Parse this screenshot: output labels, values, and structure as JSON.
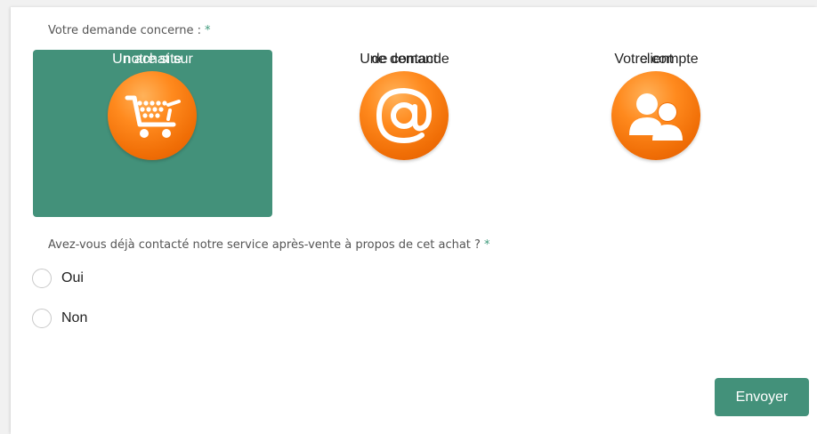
{
  "form": {
    "question1": {
      "label": "Votre demande concerne :",
      "required_mark": "*",
      "choices": [
        {
          "line1": "Un achat sur",
          "line2": "notre site",
          "icon": "shopping-cart-icon",
          "selected": true
        },
        {
          "line1": "Une demande",
          "line2": "de contact",
          "icon": "at-sign-icon",
          "selected": false
        },
        {
          "line1": "Votre compte",
          "line2": "client",
          "icon": "users-icon",
          "selected": false
        }
      ]
    },
    "question2": {
      "label": "Avez-vous déjà contacté notre service après-vente à propos de cet achat ?",
      "required_mark": "*",
      "options": [
        {
          "label": "Oui",
          "checked": false
        },
        {
          "label": "Non",
          "checked": false
        }
      ]
    },
    "submit_label": "Envoyer"
  },
  "colors": {
    "accent": "#43917a",
    "icon_orange": "#f47a12",
    "required": "#3f9a7c"
  }
}
